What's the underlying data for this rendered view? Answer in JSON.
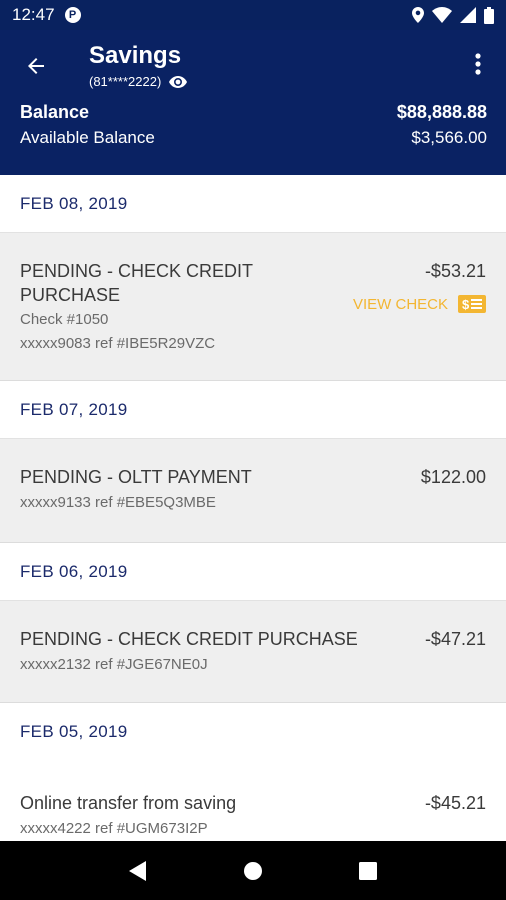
{
  "status_bar": {
    "time": "12:47",
    "app_icon": "P"
  },
  "header": {
    "title": "Savings",
    "account_masked": "(81****2222)",
    "balance_label": "Balance",
    "balance_value": "$88,888.88",
    "available_label": "Available Balance",
    "available_value": "$3,566.00"
  },
  "groups": [
    {
      "date": "FEB 08, 2019",
      "txns": [
        {
          "desc_line1": "PENDING - CHECK CREDIT",
          "desc_line2": "PURCHASE",
          "check": "Check #1050",
          "ref": "xxxxx9083 ref #IBE5R29VZC",
          "amount": "-$53.21",
          "view_check": "VIEW CHECK"
        }
      ]
    },
    {
      "date": "FEB 07, 2019",
      "txns": [
        {
          "desc": "PENDING - OLTT PAYMENT",
          "ref": "xxxxx9133 ref #EBE5Q3MBE",
          "amount": "$122.00"
        }
      ]
    },
    {
      "date": "FEB 06, 2019",
      "txns": [
        {
          "desc": "PENDING - CHECK CREDIT PURCHASE",
          "ref": "xxxxx2132 ref #JGE67NE0J",
          "amount": "-$47.21"
        }
      ]
    },
    {
      "date": "FEB 05, 2019",
      "txns": [
        {
          "desc": "Online transfer from saving",
          "ref": "xxxxx4222 ref #UGM673I2P",
          "amount": "-$45.21"
        }
      ]
    }
  ],
  "colors": {
    "header_bg": "#0a2263",
    "accent": "#f3b632",
    "date_text": "#1b2a6b"
  }
}
